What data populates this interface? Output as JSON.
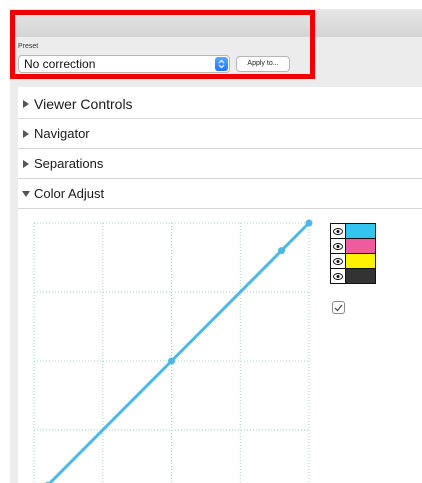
{
  "preset": {
    "label": "Preset",
    "selected_value": "No correction",
    "apply_label": "Apply to..."
  },
  "sections": [
    {
      "label": "Viewer Controls",
      "expanded": false
    },
    {
      "label": "Navigator",
      "expanded": false
    },
    {
      "label": "Separations",
      "expanded": false
    },
    {
      "label": "Color Adjust",
      "expanded": true
    }
  ],
  "color_adjust": {
    "curve_color": "#4bb8e8",
    "curve_points": [
      [
        0.05,
        0.05
      ],
      [
        0.5,
        0.5
      ],
      [
        0.9,
        0.9
      ],
      [
        1.0,
        1.0
      ]
    ],
    "channels": [
      {
        "name": "cyan",
        "color": "#33c4f0",
        "visible": true,
        "icon": "eye-icon"
      },
      {
        "name": "magenta",
        "color": "#f05a9e",
        "visible": true,
        "icon": "eye-icon"
      },
      {
        "name": "yellow",
        "color": "#fff200",
        "visible": true,
        "icon": "eye-icon"
      },
      {
        "name": "black",
        "color": "#333333",
        "visible": true,
        "icon": "eye-icon"
      }
    ],
    "checkbox_checked": true
  },
  "colors": {
    "highlight": "#ee0000",
    "accent": "#1d7af5"
  }
}
